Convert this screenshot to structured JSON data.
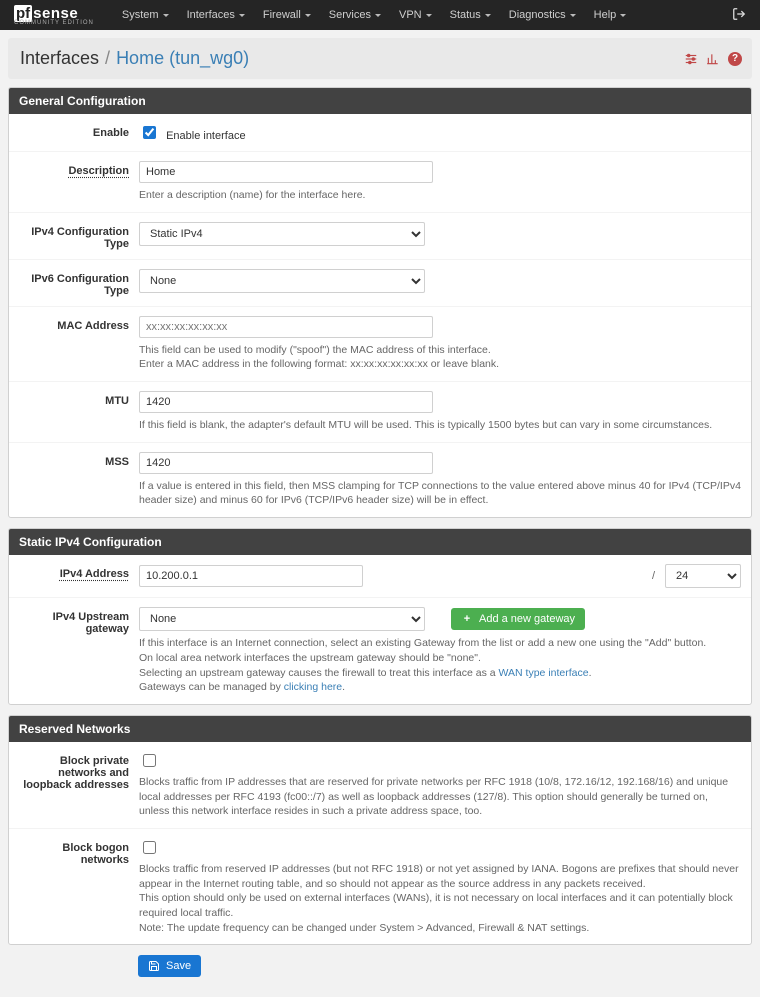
{
  "nav": {
    "brand_pf": "pf",
    "brand_sense": "sense",
    "brand_sub": "COMMUNITY EDITION",
    "items": [
      "System",
      "Interfaces",
      "Firewall",
      "Services",
      "VPN",
      "Status",
      "Diagnostics",
      "Help"
    ]
  },
  "crumb": {
    "a": "Interfaces",
    "b": "Home (tun_wg0)"
  },
  "panels": {
    "general": {
      "title": "General Configuration",
      "enable_label": "Enable",
      "enable_text": "Enable interface",
      "enable_checked": true,
      "description_label": "Description",
      "description_value": "Home",
      "description_help": "Enter a description (name) for the interface here.",
      "v4type_label": "IPv4 Configuration Type",
      "v4type_value": "Static IPv4",
      "v6type_label": "IPv6 Configuration Type",
      "v6type_value": "None",
      "mac_label": "MAC Address",
      "mac_placeholder": "xx:xx:xx:xx:xx:xx",
      "mac_help1": "This field can be used to modify (\"spoof\") the MAC address of this interface.",
      "mac_help2": "Enter a MAC address in the following format: xx:xx:xx:xx:xx:xx or leave blank.",
      "mtu_label": "MTU",
      "mtu_value": "1420",
      "mtu_help": "If this field is blank, the adapter's default MTU will be used. This is typically 1500 bytes but can vary in some circumstances.",
      "mss_label": "MSS",
      "mss_value": "1420",
      "mss_help": "If a value is entered in this field, then MSS clamping for TCP connections to the value entered above minus 40 for IPv4 (TCP/IPv4 header size) and minus 60 for IPv6 (TCP/IPv6 header size) will be in effect."
    },
    "ipv4": {
      "title": "Static IPv4 Configuration",
      "addr_label": "IPv4 Address",
      "addr_value": "10.200.0.1",
      "addr_mask": "24",
      "gw_label": "IPv4 Upstream gateway",
      "gw_value": "None",
      "gw_btn": "Add a new gateway",
      "gw_help1": "If this interface is an Internet connection, select an existing Gateway from the list or add a new one using the \"Add\" button.",
      "gw_help2": "On local area network interfaces the upstream gateway should be \"none\".",
      "gw_help3a": "Selecting an upstream gateway causes the firewall to treat this interface as a ",
      "gw_help3b": "WAN type interface",
      "gw_help4a": "Gateways can be managed by ",
      "gw_help4b": "clicking here"
    },
    "reserved": {
      "title": "Reserved Networks",
      "priv_label": "Block private networks and loopback addresses",
      "priv_help": "Blocks traffic from IP addresses that are reserved for private networks per RFC 1918 (10/8, 172.16/12, 192.168/16) and unique local addresses per RFC 4193 (fc00::/7) as well as loopback addresses (127/8). This option should generally be turned on, unless this network interface resides in such a private address space, too.",
      "bogon_label": "Block bogon networks",
      "bogon_l1": "Blocks traffic from reserved IP addresses (but not RFC 1918) or not yet assigned by IANA. Bogons are prefixes that should never appear in the Internet routing table, and so should not appear as the source address in any packets received.",
      "bogon_l2": "This option should only be used on external interfaces (WANs), it is not necessary on local interfaces and it can potentially block required local traffic.",
      "bogon_l3": "Note: The update frequency can be changed under System > Advanced, Firewall & NAT settings."
    }
  },
  "actions": {
    "save": "Save"
  }
}
